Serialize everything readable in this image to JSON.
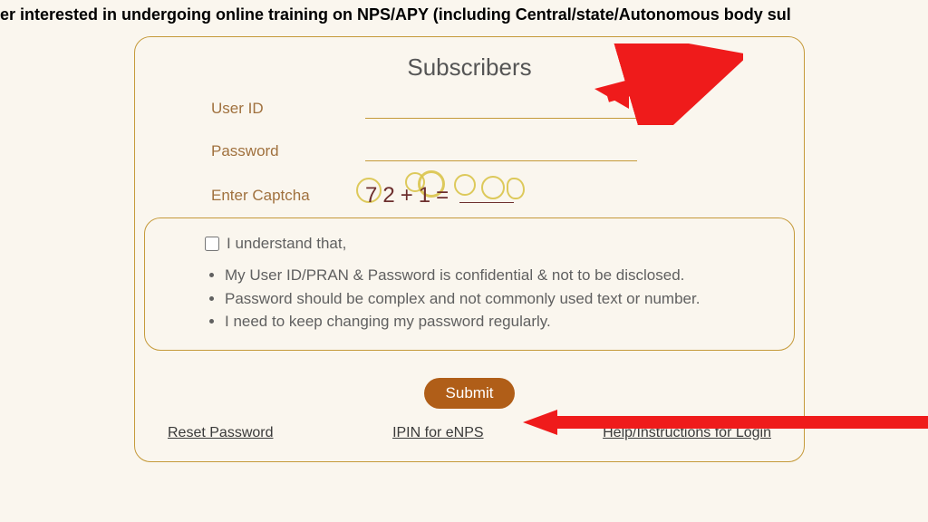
{
  "top_banner": "er interested in undergoing online training on NPS/APY (including Central/state/Autonomous body sul",
  "card": {
    "title": "Subscribers",
    "user_id_label": "User ID",
    "password_label": "Password",
    "captcha_label": "Enter Captcha",
    "captcha_expr": {
      "a": "7",
      "b": "2",
      "op": "+",
      "c": "1",
      "eq": "="
    }
  },
  "disclosure": {
    "checkbox_label": "I understand that,",
    "items": [
      "My User ID/PRAN & Password is confidential & not to be disclosed.",
      "Password should be complex and not commonly used text or number.",
      "I need to keep changing my password regularly."
    ]
  },
  "submit_label": "Submit",
  "links": {
    "reset_password": "Reset Password",
    "ipin": "IPIN for eNPS",
    "help": "Help/Instructions for Login"
  }
}
